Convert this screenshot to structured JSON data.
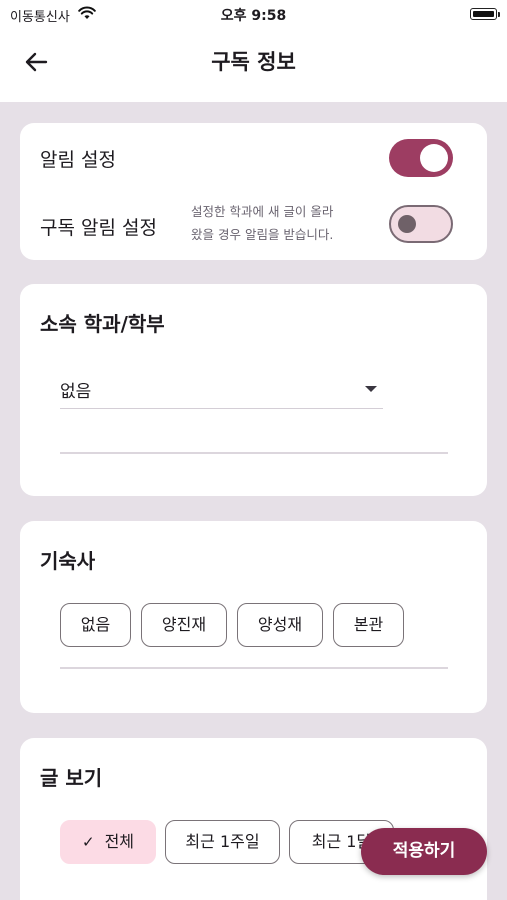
{
  "status_bar": {
    "carrier": "이동통신사",
    "time": "오후 9:58"
  },
  "header": {
    "title": "구독 정보"
  },
  "notifications": {
    "alarm_label": "알림 설정",
    "alarm_on": true,
    "subscribe_label": "구독 알림 설정",
    "subscribe_desc_line1": "설정한 학과에 새 글이 올라",
    "subscribe_desc_line2": "왔을 경우 알림을 받습니다.",
    "subscribe_on": false
  },
  "department": {
    "title": "소속 학과/학부",
    "selected": "없음"
  },
  "dormitory": {
    "title": "기숙사",
    "options": [
      "없음",
      "양진재",
      "양성재",
      "본관"
    ]
  },
  "view": {
    "title": "글 보기",
    "options": [
      "전체",
      "최근 1주일",
      "최근 1달"
    ],
    "selected": "전체"
  },
  "apply_button": "적용하기",
  "colors": {
    "accent": "#9d3d62",
    "fab": "#8a2c50",
    "selected_chip": "#fcdbe5",
    "background": "#e6e0e7"
  }
}
